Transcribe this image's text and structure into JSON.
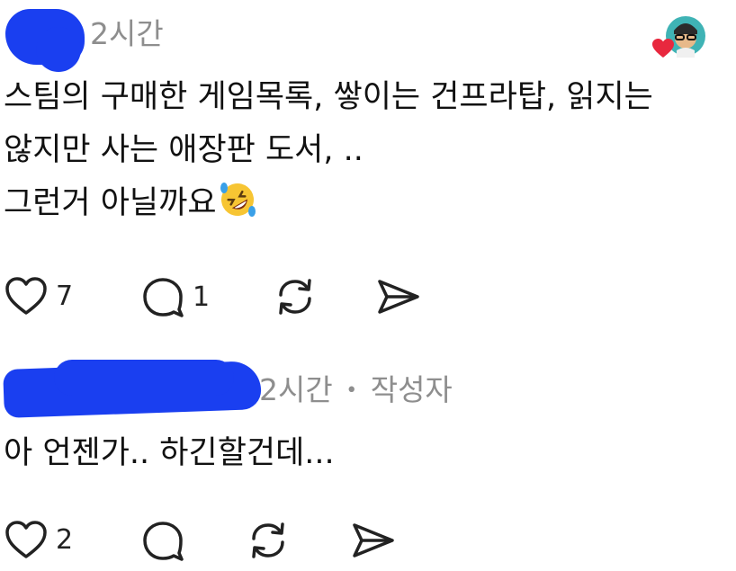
{
  "comments": [
    {
      "time": "2시간",
      "author_tag": "",
      "lines": [
        "스팀의 구매한 게임목록, 쌓이는 건프라탑, 읽지는",
        "않지만 사는 애장판 도서, ..",
        "그런거 아닐까요"
      ],
      "emoji": "rolling-on-floor-laughing",
      "likes": "7",
      "replies": "1",
      "liked_by_author": true
    },
    {
      "time": "2시간",
      "separator": "•",
      "author_tag": "작성자",
      "lines": [
        "아 언젠가.. 하긴할건데..."
      ],
      "likes": "2",
      "replies": ""
    }
  ],
  "icons": {
    "like": "heart-outline-icon",
    "reply": "speech-bubble-icon",
    "repost": "repost-icon",
    "share": "send-icon",
    "author_like": "red-heart-icon"
  },
  "colors": {
    "redaction": "#1a3ff0",
    "meta_text": "#8e8e8e",
    "heart": "#e8283e"
  }
}
